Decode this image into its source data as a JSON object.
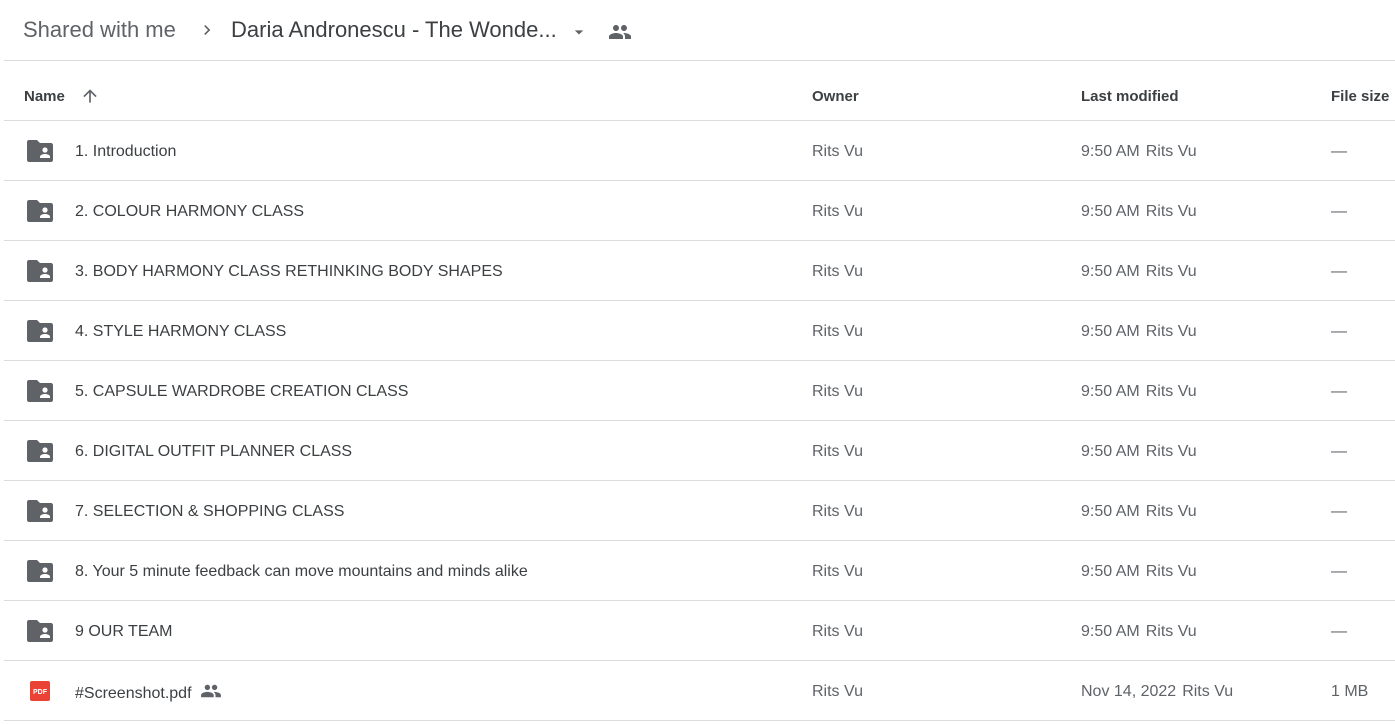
{
  "breadcrumb": {
    "root": "Shared with me",
    "current": "Daria Andronescu - The Wonde..."
  },
  "columns": {
    "name": "Name",
    "owner": "Owner",
    "last_modified": "Last modified",
    "file_size": "File size"
  },
  "icons": {
    "folder": "shared-folder-icon",
    "pdf": "pdf-file-icon",
    "shared": "people-icon",
    "sort": "arrow-up-icon"
  },
  "colors": {
    "folder": "#5f6368",
    "pdf": "#ea4335"
  },
  "rows": [
    {
      "name": "1. Introduction",
      "owner": "Rits Vu",
      "modified": "9:50 AM",
      "modified_by": "Rits Vu",
      "size": "—"
    },
    {
      "name": "2. COLOUR HARMONY CLASS",
      "owner": "Rits Vu",
      "modified": "9:50 AM",
      "modified_by": "Rits Vu",
      "size": "—"
    },
    {
      "name": "3. BODY HARMONY CLASS RETHINKING BODY SHAPES",
      "owner": "Rits Vu",
      "modified": "9:50 AM",
      "modified_by": "Rits Vu",
      "size": "—"
    },
    {
      "name": "4. STYLE HARMONY CLASS",
      "owner": "Rits Vu",
      "modified": "9:50 AM",
      "modified_by": "Rits Vu",
      "size": "—"
    },
    {
      "name": "5. CAPSULE WARDROBE CREATION CLASS",
      "owner": "Rits Vu",
      "modified": "9:50 AM",
      "modified_by": "Rits Vu",
      "size": "—"
    },
    {
      "name": "6. DIGITAL OUTFIT PLANNER CLASS",
      "owner": "Rits Vu",
      "modified": "9:50 AM",
      "modified_by": "Rits Vu",
      "size": "—"
    },
    {
      "name": "7. SELECTION & SHOPPING CLASS",
      "owner": "Rits Vu",
      "modified": "9:50 AM",
      "modified_by": "Rits Vu",
      "size": "—"
    },
    {
      "name": "8. Your 5 minute feedback can move mountains and minds alike",
      "owner": "Rits Vu",
      "modified": "9:50 AM",
      "modified_by": "Rits Vu",
      "size": "—"
    },
    {
      "name": "9 OUR TEAM",
      "owner": "Rits Vu",
      "modified": "9:50 AM",
      "modified_by": "Rits Vu",
      "size": "—"
    },
    {
      "name": "#Screenshot.pdf",
      "owner": "Rits Vu",
      "modified": "Nov 14, 2022",
      "modified_by": "Rits Vu",
      "size": "1 MB"
    }
  ]
}
